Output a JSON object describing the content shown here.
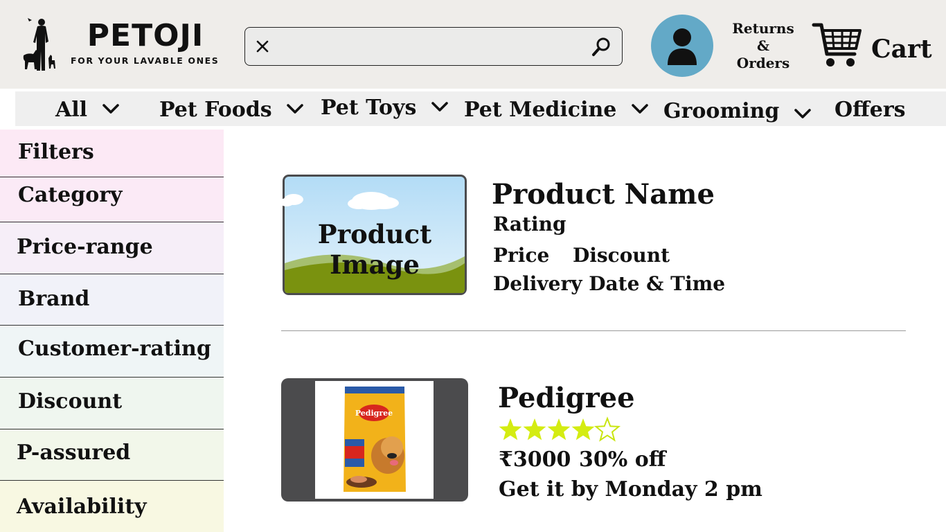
{
  "brand": {
    "name": "PETOJI",
    "tagline": "FOR YOUR LAVABLE ONES"
  },
  "search": {
    "value": "",
    "placeholder": ""
  },
  "header": {
    "returns_line1": "Returns",
    "returns_line2": "&",
    "returns_line3": "Orders",
    "cart_label": "Cart"
  },
  "nav": {
    "items": [
      {
        "label": "All",
        "has_dropdown": true
      },
      {
        "label": "Pet Foods",
        "has_dropdown": true
      },
      {
        "label": "Pet Toys",
        "has_dropdown": true
      },
      {
        "label": "Pet Medicine",
        "has_dropdown": true
      },
      {
        "label": "Grooming",
        "has_dropdown": true
      },
      {
        "label": "Offers",
        "has_dropdown": false
      }
    ]
  },
  "filters": {
    "title": "Filters",
    "items": [
      "Category",
      "Price-range",
      "Brand",
      "Customer-rating",
      "Discount",
      "P-assured",
      "Availability"
    ]
  },
  "products": [
    {
      "image_label": "Product Image",
      "name": "Product Name",
      "rating_label": "Rating",
      "price": "Price",
      "discount": "Discount",
      "delivery": "Delivery Date & Time"
    },
    {
      "image_name": "pedigree-dog-food-pack",
      "name": "Pedigree",
      "rating_stars": 4,
      "rating_max": 5,
      "price": "₹3000",
      "discount": "30% off",
      "delivery": "Get it by Monday 2 pm"
    }
  ],
  "colors": {
    "header_bg": "#efedea",
    "avatar_bg": "#63a9c7",
    "star": "#d4ec12",
    "card_frame": "#4b4b4d"
  }
}
